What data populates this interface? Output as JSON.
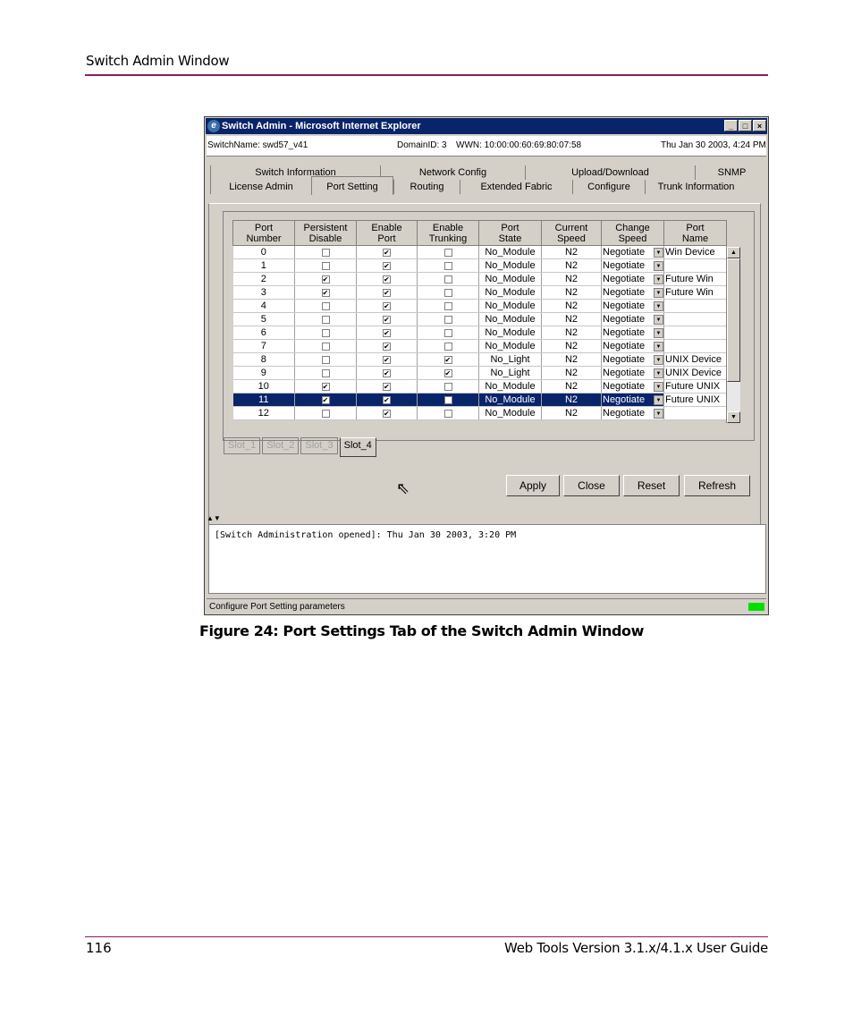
{
  "header": {
    "running_title": "Switch Admin Window"
  },
  "footer": {
    "page_number": "116",
    "guide_title": "Web Tools Version 3.1.x/4.1.x User Guide"
  },
  "caption": "Figure 24:  Port Settings Tab of the Switch Admin Window",
  "window": {
    "title": "Switch Admin - Microsoft Internet Explorer",
    "buttons": [
      "_",
      "□",
      "×"
    ],
    "info": {
      "switch_name": "SwitchName: swd57_v41",
      "domain": "DomainID: 3",
      "wwn": "WWN: 10:00:00:60:69:80:07:58",
      "date": "Thu Jan 30  2003, 4:24 PM"
    },
    "tabs_row1": [
      "Switch Information",
      "Network Config",
      "Upload/Download",
      "SNMP"
    ],
    "tabs_row2": [
      "License Admin",
      "Port Setting",
      "Routing",
      "Extended Fabric",
      "Configure",
      "Trunk Information"
    ],
    "active_tab": "Port Setting",
    "table": {
      "headers": [
        [
          "Port",
          "Number"
        ],
        [
          "Persistent",
          "Disable"
        ],
        [
          "Enable",
          "Port"
        ],
        [
          "Enable",
          "Trunking"
        ],
        [
          "Port",
          "State"
        ],
        [
          "Current",
          "Speed"
        ],
        [
          "Change",
          "Speed"
        ],
        [
          "Port",
          "Name"
        ]
      ],
      "rows": [
        {
          "num": "0",
          "persist": false,
          "enable": true,
          "trunk": false,
          "state": "No_Module",
          "cur": "N2",
          "change": "Negotiate",
          "name": "Win Device"
        },
        {
          "num": "1",
          "persist": false,
          "enable": true,
          "trunk": false,
          "state": "No_Module",
          "cur": "N2",
          "change": "Negotiate",
          "name": ""
        },
        {
          "num": "2",
          "persist": true,
          "enable": true,
          "trunk": false,
          "state": "No_Module",
          "cur": "N2",
          "change": "Negotiate",
          "name": "Future Win"
        },
        {
          "num": "3",
          "persist": true,
          "enable": true,
          "trunk": false,
          "state": "No_Module",
          "cur": "N2",
          "change": "Negotiate",
          "name": "Future Win"
        },
        {
          "num": "4",
          "persist": false,
          "enable": true,
          "trunk": false,
          "state": "No_Module",
          "cur": "N2",
          "change": "Negotiate",
          "name": ""
        },
        {
          "num": "5",
          "persist": false,
          "enable": true,
          "trunk": false,
          "state": "No_Module",
          "cur": "N2",
          "change": "Negotiate",
          "name": ""
        },
        {
          "num": "6",
          "persist": false,
          "enable": true,
          "trunk": false,
          "state": "No_Module",
          "cur": "N2",
          "change": "Negotiate",
          "name": ""
        },
        {
          "num": "7",
          "persist": false,
          "enable": true,
          "trunk": false,
          "state": "No_Module",
          "cur": "N2",
          "change": "Negotiate",
          "name": ""
        },
        {
          "num": "8",
          "persist": false,
          "enable": true,
          "trunk": true,
          "state": "No_Light",
          "cur": "N2",
          "change": "Negotiate",
          "name": "UNIX Device"
        },
        {
          "num": "9",
          "persist": false,
          "enable": true,
          "trunk": true,
          "state": "No_Light",
          "cur": "N2",
          "change": "Negotiate",
          "name": "UNIX Device"
        },
        {
          "num": "10",
          "persist": true,
          "enable": true,
          "trunk": false,
          "state": "No_Module",
          "cur": "N2",
          "change": "Negotiate",
          "name": "Future UNIX"
        },
        {
          "num": "11",
          "persist": true,
          "enable": true,
          "trunk": false,
          "state": "No_Module",
          "cur": "N2",
          "change": "Negotiate",
          "name": "Future UNIX",
          "selected": true
        },
        {
          "num": "12",
          "persist": false,
          "enable": true,
          "trunk": false,
          "state": "No_Module",
          "cur": "N2",
          "change": "Negotiate",
          "name": ""
        }
      ]
    },
    "slots": [
      "Slot_1",
      "Slot_2",
      "Slot_3",
      "Slot_4"
    ],
    "active_slot": "Slot_4",
    "action_buttons": {
      "apply": "Apply",
      "close": "Close",
      "reset": "Reset",
      "refresh": "Refresh"
    },
    "log_text": "[Switch Administration opened]: Thu Jan 30  2003, 3:20 PM",
    "status_text": "Configure Port Setting parameters",
    "colors": {
      "titlebar": "#0a246a",
      "selection": "#0a246a",
      "status_ok": "#00e000",
      "rule": "#8a1d5e"
    }
  }
}
